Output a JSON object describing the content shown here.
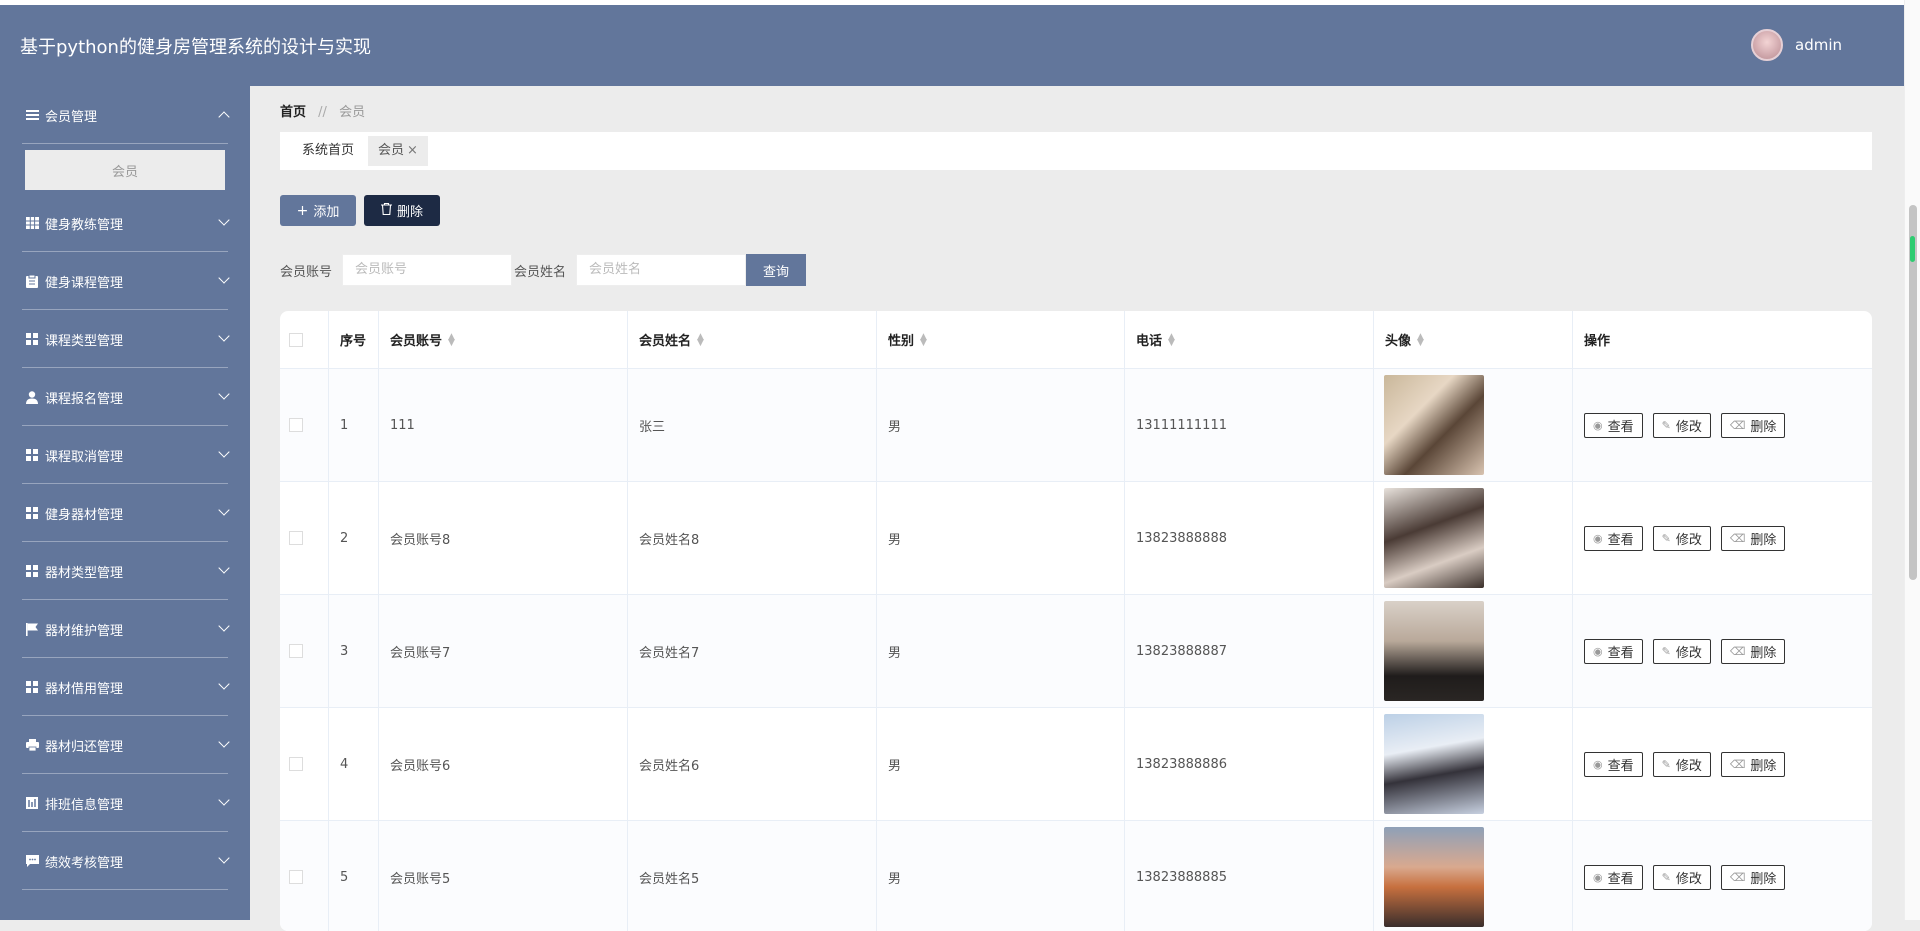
{
  "app": {
    "title": "基于python的健身房管理系统的设计与实现",
    "username": "admin"
  },
  "sidebar": {
    "items": [
      {
        "label": "会员管理",
        "icon": "menu-icon",
        "expanded": true,
        "sub": [
          "会员"
        ]
      },
      {
        "label": "健身教练管理",
        "icon": "grid-icon"
      },
      {
        "label": "健身课程管理",
        "icon": "clipboard-icon"
      },
      {
        "label": "课程类型管理",
        "icon": "apps-icon"
      },
      {
        "label": "课程报名管理",
        "icon": "user-icon"
      },
      {
        "label": "课程取消管理",
        "icon": "apps-icon"
      },
      {
        "label": "健身器材管理",
        "icon": "apps-icon"
      },
      {
        "label": "器材类型管理",
        "icon": "apps-icon"
      },
      {
        "label": "器材维护管理",
        "icon": "flag-icon"
      },
      {
        "label": "器材借用管理",
        "icon": "apps-icon"
      },
      {
        "label": "器材归还管理",
        "icon": "printer-icon"
      },
      {
        "label": "排班信息管理",
        "icon": "bar-chart-icon"
      },
      {
        "label": "绩效考核管理",
        "icon": "chat-icon"
      }
    ]
  },
  "breadcrumb": {
    "home": "首页",
    "sep": "//",
    "current": "会员"
  },
  "tabs": [
    {
      "label": "系统首页"
    },
    {
      "label": "会员",
      "close": "×"
    }
  ],
  "toolbar": {
    "add_label": "添加",
    "delete_label": "删除"
  },
  "search": {
    "account_label": "会员账号",
    "account_placeholder": "会员账号",
    "name_label": "会员姓名",
    "name_placeholder": "会员姓名",
    "query_label": "查询"
  },
  "table": {
    "columns": [
      "序号",
      "会员账号",
      "会员姓名",
      "性别",
      "电话",
      "头像",
      "操作"
    ],
    "rows": [
      {
        "index": "1",
        "account": "111",
        "name": "张三",
        "gender": "男",
        "phone": "13111111111"
      },
      {
        "index": "2",
        "account": "会员账号8",
        "name": "会员姓名8",
        "gender": "男",
        "phone": "13823888888"
      },
      {
        "index": "3",
        "account": "会员账号7",
        "name": "会员姓名7",
        "gender": "男",
        "phone": "13823888887"
      },
      {
        "index": "4",
        "account": "会员账号6",
        "name": "会员姓名6",
        "gender": "男",
        "phone": "13823888886"
      },
      {
        "index": "5",
        "account": "会员账号5",
        "name": "会员姓名5",
        "gender": "男",
        "phone": "13823888885"
      }
    ],
    "actions": {
      "view": "查看",
      "edit": "修改",
      "delete": "删除"
    }
  },
  "colors": {
    "primary": "#62769b",
    "dark": "#1d2a44",
    "background": "#ececec"
  }
}
